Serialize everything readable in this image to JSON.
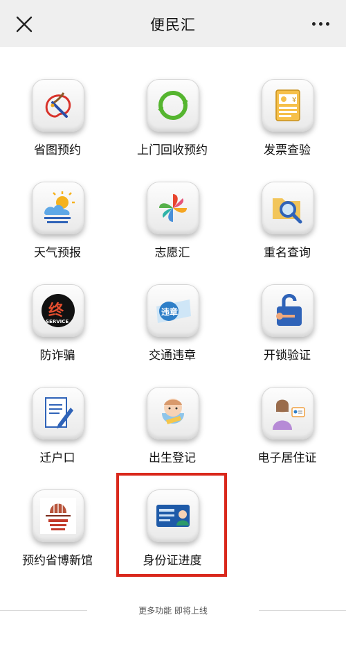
{
  "header": {
    "title": "便民汇"
  },
  "services": [
    {
      "label": "省图预约",
      "icon": "palette-icon"
    },
    {
      "label": "上门回收预约",
      "icon": "recycle-icon"
    },
    {
      "label": "发票查验",
      "icon": "invoice-icon"
    },
    {
      "label": "天气预报",
      "icon": "weather-icon"
    },
    {
      "label": "志愿汇",
      "icon": "pinwheel-icon"
    },
    {
      "label": "重名查询",
      "icon": "folder-search-icon"
    },
    {
      "label": "防诈骗",
      "icon": "anti-fraud-icon"
    },
    {
      "label": "交通违章",
      "icon": "traffic-violation-icon"
    },
    {
      "label": "开锁验证",
      "icon": "unlock-icon"
    },
    {
      "label": "迁户口",
      "icon": "document-pen-icon"
    },
    {
      "label": "出生登记",
      "icon": "baby-icon"
    },
    {
      "label": "电子居住证",
      "icon": "id-card-person-icon"
    },
    {
      "label": "预约省博新馆",
      "icon": "museum-icon"
    },
    {
      "label": "身份证进度",
      "icon": "id-card-icon"
    }
  ],
  "icon_text": {
    "traffic": "违章",
    "anti_fraud_top": "终",
    "anti_fraud_bottom": "SERVICE",
    "yen": "¥"
  },
  "footer": {
    "text": "更多功能 即将上线"
  },
  "highlight_color": "#d9281c"
}
